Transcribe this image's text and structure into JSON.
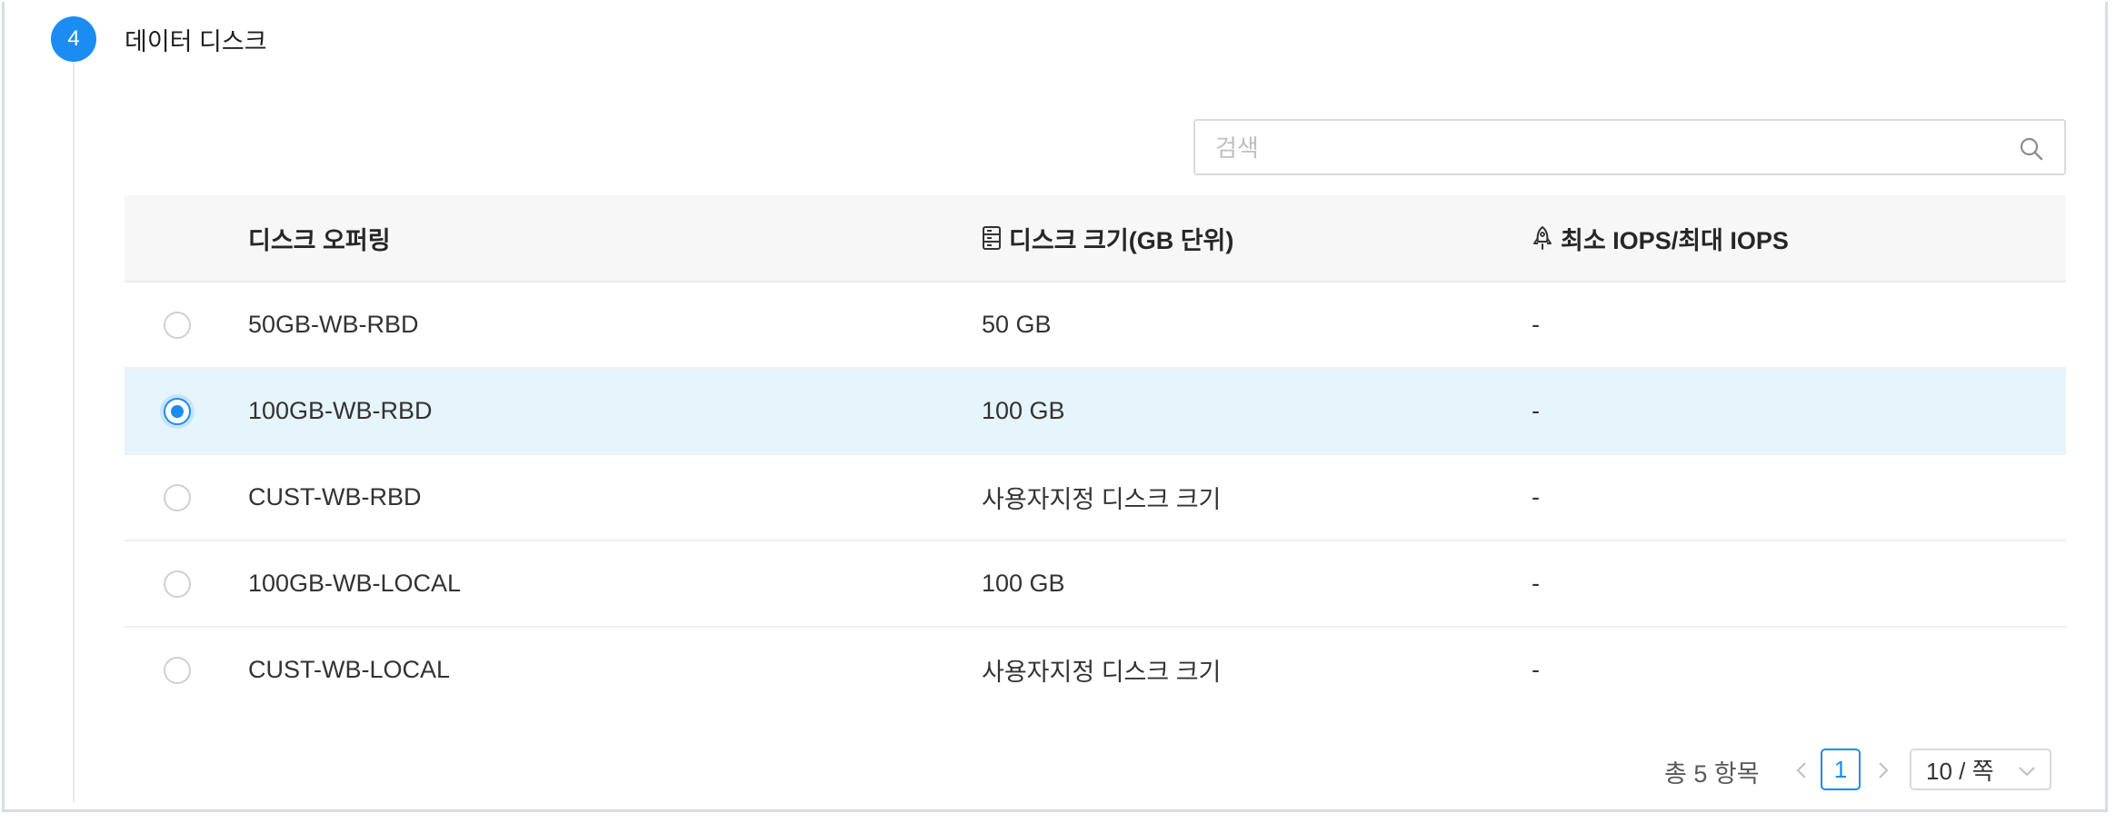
{
  "section": {
    "step_number": "4",
    "title": "데이터 디스크"
  },
  "search": {
    "placeholder": "검색",
    "value": ""
  },
  "table": {
    "columns": [
      {
        "label": "디스크 오퍼링",
        "icon": ""
      },
      {
        "label": "디스크 크기(GB 단위)",
        "icon": "storage-icon"
      },
      {
        "label": "최소 IOPS/최대 IOPS",
        "icon": "rocket-icon"
      }
    ],
    "rows": [
      {
        "name": "50GB-WB-RBD",
        "size": "50 GB",
        "iops": "-",
        "selected": false
      },
      {
        "name": "100GB-WB-RBD",
        "size": "100 GB",
        "iops": "-",
        "selected": true
      },
      {
        "name": "CUST-WB-RBD",
        "size": "사용자지정 디스크 크기",
        "iops": "-",
        "selected": false
      },
      {
        "name": "100GB-WB-LOCAL",
        "size": "100 GB",
        "iops": "-",
        "selected": false
      },
      {
        "name": "CUST-WB-LOCAL",
        "size": "사용자지정 디스크 크기",
        "iops": "-",
        "selected": false
      }
    ]
  },
  "pagination": {
    "total_text": "총 5 항목",
    "current_page": "1",
    "page_size": "10 / 쪽"
  },
  "colors": {
    "accent": "#1b8cf2",
    "selected_row": "#e6f4fc"
  }
}
